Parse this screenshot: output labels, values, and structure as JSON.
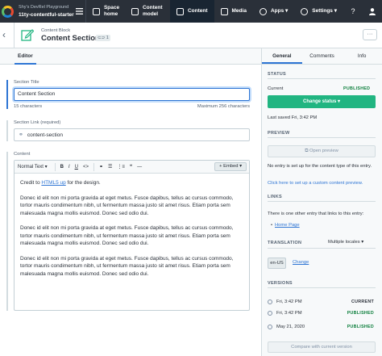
{
  "space": {
    "subtitle": "Shy's DevRel Playground",
    "name": "11ty-contentful-starter"
  },
  "nav": {
    "items": [
      {
        "label": "Space home",
        "icon": "home-icon"
      },
      {
        "label": "Content model",
        "icon": "content-model-icon"
      },
      {
        "label": "Content",
        "icon": "content-icon",
        "active": true
      },
      {
        "label": "Media",
        "icon": "media-icon"
      },
      {
        "label": "Apps",
        "icon": "apps-icon"
      },
      {
        "label": "Settings",
        "icon": "settings-icon"
      }
    ],
    "apps_suffix": "▾",
    "settings_suffix": "▾"
  },
  "entry": {
    "content_type": "Content Block",
    "title": "Content Section",
    "reference_count": "⊂⊃ 1",
    "more": "···"
  },
  "editor_tab": "Editor",
  "fields": {
    "section_title": {
      "label": "Section Title",
      "value": "Content Section",
      "counter": "15 characters",
      "max": "Maximum 256 characters"
    },
    "section_link": {
      "label": "Section Link (required)",
      "value": "content-section"
    },
    "content": {
      "label": "Content",
      "toolbar": {
        "format": "Normal Text ▾",
        "bold": "B",
        "italic": "I",
        "underline": "U",
        "code": "<>",
        "list_ul": "☰",
        "list_ol": "⋮≡",
        "quote": "❝",
        "hr": "—",
        "link": "⚭",
        "embed": "+ Embed ▾"
      },
      "credit_prefix": "Credit to ",
      "credit_link": "HTML5 up",
      "credit_suffix": " for the design.",
      "paragraphs": [
        "Donec id elit non mi porta gravida at eget metus. Fusce dapibus, tellus ac cursus commodo, tortor mauris condimentum nibh, ut fermentum massa justo sit amet risus. Etiam porta sem malesuada magna mollis euismod. Donec sed odio dui.",
        "Donec id elit non mi porta gravida at eget metus. Fusce dapibus, tellus ac cursus commodo, tortor mauris condimentum nibh, ut fermentum massa justo sit amet risus. Etiam porta sem malesuada magna mollis euismod. Donec sed odio dui.",
        "Donec id elit non mi porta gravida at eget metus. Fusce dapibus, tellus ac cursus commodo, tortor mauris condimentum nibh, ut fermentum massa justo sit amet risus. Etiam porta sem malesuada magna mollis euismod. Donec sed odio dui."
      ]
    }
  },
  "sidebar": {
    "tabs": [
      "General",
      "Comments",
      "Info"
    ],
    "status": {
      "heading": "STATUS",
      "current_label": "Current",
      "current_value": "PUBLISHED",
      "change_button": "Change status ▾",
      "last_saved": "Last saved Fri, 3:42 PM"
    },
    "preview": {
      "heading": "PREVIEW",
      "open_button": "⧉ Open preview",
      "note": "No entry is set up for the content type of this entry.",
      "setup_link": "Click here to set up a custom content preview."
    },
    "links": {
      "heading": "LINKS",
      "text": "There is one other entry that links to this entry:",
      "entry": "Home Page"
    },
    "translation": {
      "heading": "TRANSLATION",
      "mode": "Multiple locales ▾",
      "locale": "en-US",
      "change": "Change"
    },
    "versions": {
      "heading": "VERSIONS",
      "rows": [
        {
          "date": "Fri, 3:42 PM",
          "status": "CURRENT",
          "color": "#2a3039"
        },
        {
          "date": "Fri, 3:42 PM",
          "status": "PUBLISHED",
          "color": "#0b7e3b"
        },
        {
          "date": "May 21, 2020",
          "status": "PUBLISHED",
          "color": "#0b7e3b"
        }
      ],
      "compare_button": "Compare with current version"
    }
  },
  "colors": {
    "topbar": "#2a3039",
    "accent": "#2e75d4",
    "positive": "#21b581",
    "published": "#0b7e3b"
  }
}
